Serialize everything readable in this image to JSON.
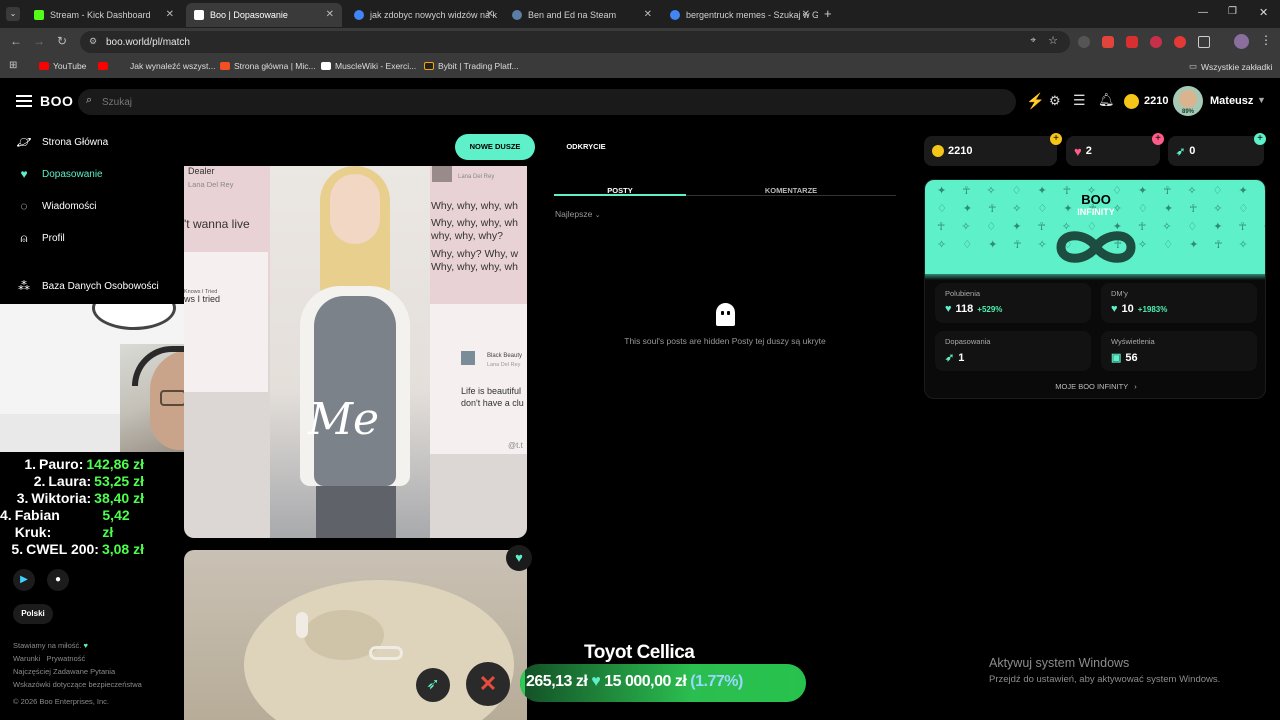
{
  "browser": {
    "tabs": [
      {
        "title": "Stream - Kick Dashboard",
        "color": "#53fc18"
      },
      {
        "title": "Boo | Dopasowanie",
        "color": "#ffffff"
      },
      {
        "title": "jak zdobyc nowych widzów na k",
        "color": "#4285f4"
      },
      {
        "title": "Ben and Ed na Steam",
        "color": "#1b2838"
      },
      {
        "title": "bergentruck memes - Szukaj w G",
        "color": "#4285f4"
      }
    ],
    "url": "boo.world/pl/match",
    "bookmarks": [
      "YouTube",
      "Jak wynaleźć wszyst...",
      "Strona główna | Mic...",
      "MuscleWiki - Exerci...",
      "Bybit | Trading Platf..."
    ],
    "all_bookmarks": "Wszystkie zakładki"
  },
  "app": {
    "logo": "BOO",
    "search_placeholder": "Szukaj",
    "coins": "2210",
    "username": "Mateusz",
    "avatar_badge": "89%",
    "accent": "#5ef0c8"
  },
  "sidebar": {
    "items": [
      {
        "label": "Strona Główna",
        "icon": "planet-icon"
      },
      {
        "label": "Dopasowanie",
        "icon": "heart-icon"
      },
      {
        "label": "Wiadomości",
        "icon": "chat-icon"
      },
      {
        "label": "Profil",
        "icon": "bell-icon"
      },
      {
        "label": "Baza Danych Osobowości",
        "icon": "grid-icon"
      }
    ],
    "language": "Polski",
    "footer": {
      "tagline": "Stawiamy na miłość.",
      "links": [
        "Warunki",
        "Prywatność",
        "Najczęściej Zadawane Pytania",
        "Wskazówki dotyczące bezpieczeństwa"
      ],
      "copyright": "© 2026 Boo Enterprises, Inc."
    }
  },
  "leaderboard": [
    {
      "rank": "1.",
      "name": "Pauro:",
      "amount": "142,86 zł"
    },
    {
      "rank": "2.",
      "name": "Laura:",
      "amount": "53,25 zł"
    },
    {
      "rank": "3.",
      "name": "Wiktoria:",
      "amount": "38,40 zł"
    },
    {
      "rank": "4.",
      "name": "Fabian Kruk:",
      "amount": "5,42 zł"
    },
    {
      "rank": "5.",
      "name": "CWEL 200:",
      "amount": "3,08 zł"
    }
  ],
  "feed": {
    "btn_new_souls": "NOWE DUSZE",
    "btn_discovery": "ODKRYCIE",
    "card1": {
      "meme_left_top": "Dealer",
      "meme_left_artist": "Lana Del Rey",
      "meme_left_line": "'t wanna live",
      "meme_left_mid": "Knows I Tried",
      "meme_left_bottom": "ws I tried",
      "meme_right_artist": "Lana Del Rey",
      "meme_right_lines": [
        "Why, why, why, wh",
        "Why, why, why, wh",
        "why, why, why?",
        "Why, why? Why, w",
        "Why, why, why, wh"
      ],
      "meme_right_song": "Black Beauty",
      "meme_right_artist2": "Lana Del Rey",
      "meme_right_tail": [
        "Life is beautiful",
        "don't have a clu"
      ],
      "caption": "Me",
      "watermark": "@t.t"
    },
    "username": "Toyot Cellica"
  },
  "profile_tabs": {
    "posts": "POSTY",
    "comments": "KOMENTARZE",
    "sort": "Najlepsze"
  },
  "hidden_msg": "This soul's posts are hidden Posty tej duszy są ukryte",
  "right_panel": {
    "coins": "2210",
    "hearts": "2",
    "boosts": "0",
    "infinity_title": "BOO",
    "infinity_sub": "INFINITY",
    "stats": [
      {
        "label": "Polubienia",
        "value": "118",
        "pct": "+529%"
      },
      {
        "label": "DM'y",
        "value": "10",
        "pct": "+1983%"
      },
      {
        "label": "Dopasowania",
        "value": "1",
        "pct": ""
      },
      {
        "label": "Wyświetlenia",
        "value": "56",
        "pct": ""
      }
    ],
    "my_infinity": "MOJE BOO INFINITY"
  },
  "donation_bar": {
    "current": "265,13 zł",
    "goal": "15 000,00 zł",
    "pct_text": "(1.77%)",
    "progress_pct": 1.77
  },
  "windows_watermark": {
    "title": "Aktywuj system Windows",
    "sub": "Przejdź do ustawień, aby aktywować system Windows."
  }
}
